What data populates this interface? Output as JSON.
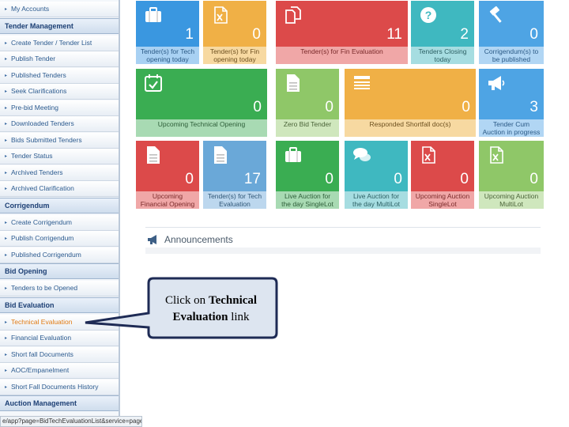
{
  "sidebar": {
    "items": [
      {
        "type": "item",
        "label": "My Accounts"
      },
      {
        "type": "header",
        "label": "Tender Management"
      },
      {
        "type": "item",
        "label": "Create Tender / Tender List"
      },
      {
        "type": "item",
        "label": "Publish Tender"
      },
      {
        "type": "item",
        "label": "Published Tenders"
      },
      {
        "type": "item",
        "label": "Seek Clarifications"
      },
      {
        "type": "item",
        "label": "Pre-bid Meeting"
      },
      {
        "type": "item",
        "label": "Downloaded Tenders"
      },
      {
        "type": "item",
        "label": "Bids Submitted Tenders"
      },
      {
        "type": "item",
        "label": "Tender Status"
      },
      {
        "type": "item",
        "label": "Archived Tenders"
      },
      {
        "type": "item",
        "label": "Archived Clarification"
      },
      {
        "type": "header",
        "label": "Corrigendum"
      },
      {
        "type": "item",
        "label": "Create Corrigendum"
      },
      {
        "type": "item",
        "label": "Publish Corrigendum"
      },
      {
        "type": "item",
        "label": "Published Corrigendum"
      },
      {
        "type": "header",
        "label": "Bid Opening"
      },
      {
        "type": "item",
        "label": "Tenders to be Opened"
      },
      {
        "type": "header",
        "label": "Bid Evaluation"
      },
      {
        "type": "item",
        "label": "Technical Evaluation",
        "active": true
      },
      {
        "type": "item",
        "label": "Financial Evaluation"
      },
      {
        "type": "item",
        "label": "Short fall Documents"
      },
      {
        "type": "item",
        "label": "AOC/Empanelment"
      },
      {
        "type": "item",
        "label": "Short Fall Documents History"
      },
      {
        "type": "header",
        "label": "Auction Management"
      }
    ]
  },
  "tiles": [
    {
      "label1": "Tender(s) for Tech",
      "label2": "opening today",
      "count": "1",
      "color": "blue",
      "icon": "briefcase-icon"
    },
    {
      "label1": "Tender(s) for Fin",
      "label2": "opening today",
      "count": "0",
      "color": "orange",
      "icon": "excel-file-icon"
    },
    {
      "label1": "Tender(s) for Fin Evaluation",
      "label2": "",
      "count": "11",
      "color": "red",
      "icon": "copy-documents-icon"
    },
    {
      "label1": "Tenders Closing",
      "label2": "today",
      "count": "2",
      "color": "teal",
      "icon": "question-circle-icon"
    },
    {
      "label1": "Corrigendum(s) to",
      "label2": "be published",
      "count": "0",
      "color": "sky",
      "icon": "gavel-icon"
    },
    {
      "label1": "Upcoming Technical Opening",
      "label2": "",
      "count": "0",
      "color": "green",
      "icon": "calendar-check-icon"
    },
    {
      "label1": "Zero Bid Tender",
      "label2": "",
      "count": "0",
      "color": "lgreen",
      "icon": "document-icon"
    },
    {
      "label1": "Responded Shortfall doc(s)",
      "label2": "",
      "count": "0",
      "color": "orange",
      "icon": "list-icon"
    },
    {
      "label1": "Tender Cum",
      "label2": "Auction in progress",
      "count": "3",
      "color": "sky",
      "icon": "megaphone-icon"
    },
    {
      "label1": "Upcoming",
      "label2": "Financial Opening",
      "count": "0",
      "color": "red",
      "icon": "document-icon"
    },
    {
      "label1": "Tender(s) for Tech",
      "label2": "Evaluation",
      "count": "17",
      "color": "lblue",
      "icon": "document-icon"
    },
    {
      "label1": "Live Auction for",
      "label2": "the day SingleLot",
      "count": "0",
      "color": "green",
      "icon": "briefcase-icon"
    },
    {
      "label1": "Live Auction for",
      "label2": "the day MultiLot",
      "count": "0",
      "color": "teal",
      "icon": "chat-bubbles-icon"
    },
    {
      "label1": "Upcoming Auction",
      "label2": "SingleLot",
      "count": "0",
      "color": "red",
      "icon": "excel-file-icon"
    },
    {
      "label1": "Upcoming Auction",
      "label2": "MultiLot",
      "count": "0",
      "color": "lgreen",
      "icon": "excel-file-icon"
    }
  ],
  "announcements": {
    "title": "Announcements",
    "icon": "megaphone-icon"
  },
  "callout": {
    "pre": "Click on ",
    "bold1": "Technical",
    "bold2": "Evaluation",
    "post": " link"
  },
  "statusbar": {
    "url": "e/app?page=BidTechEvaluationList&service=page"
  }
}
